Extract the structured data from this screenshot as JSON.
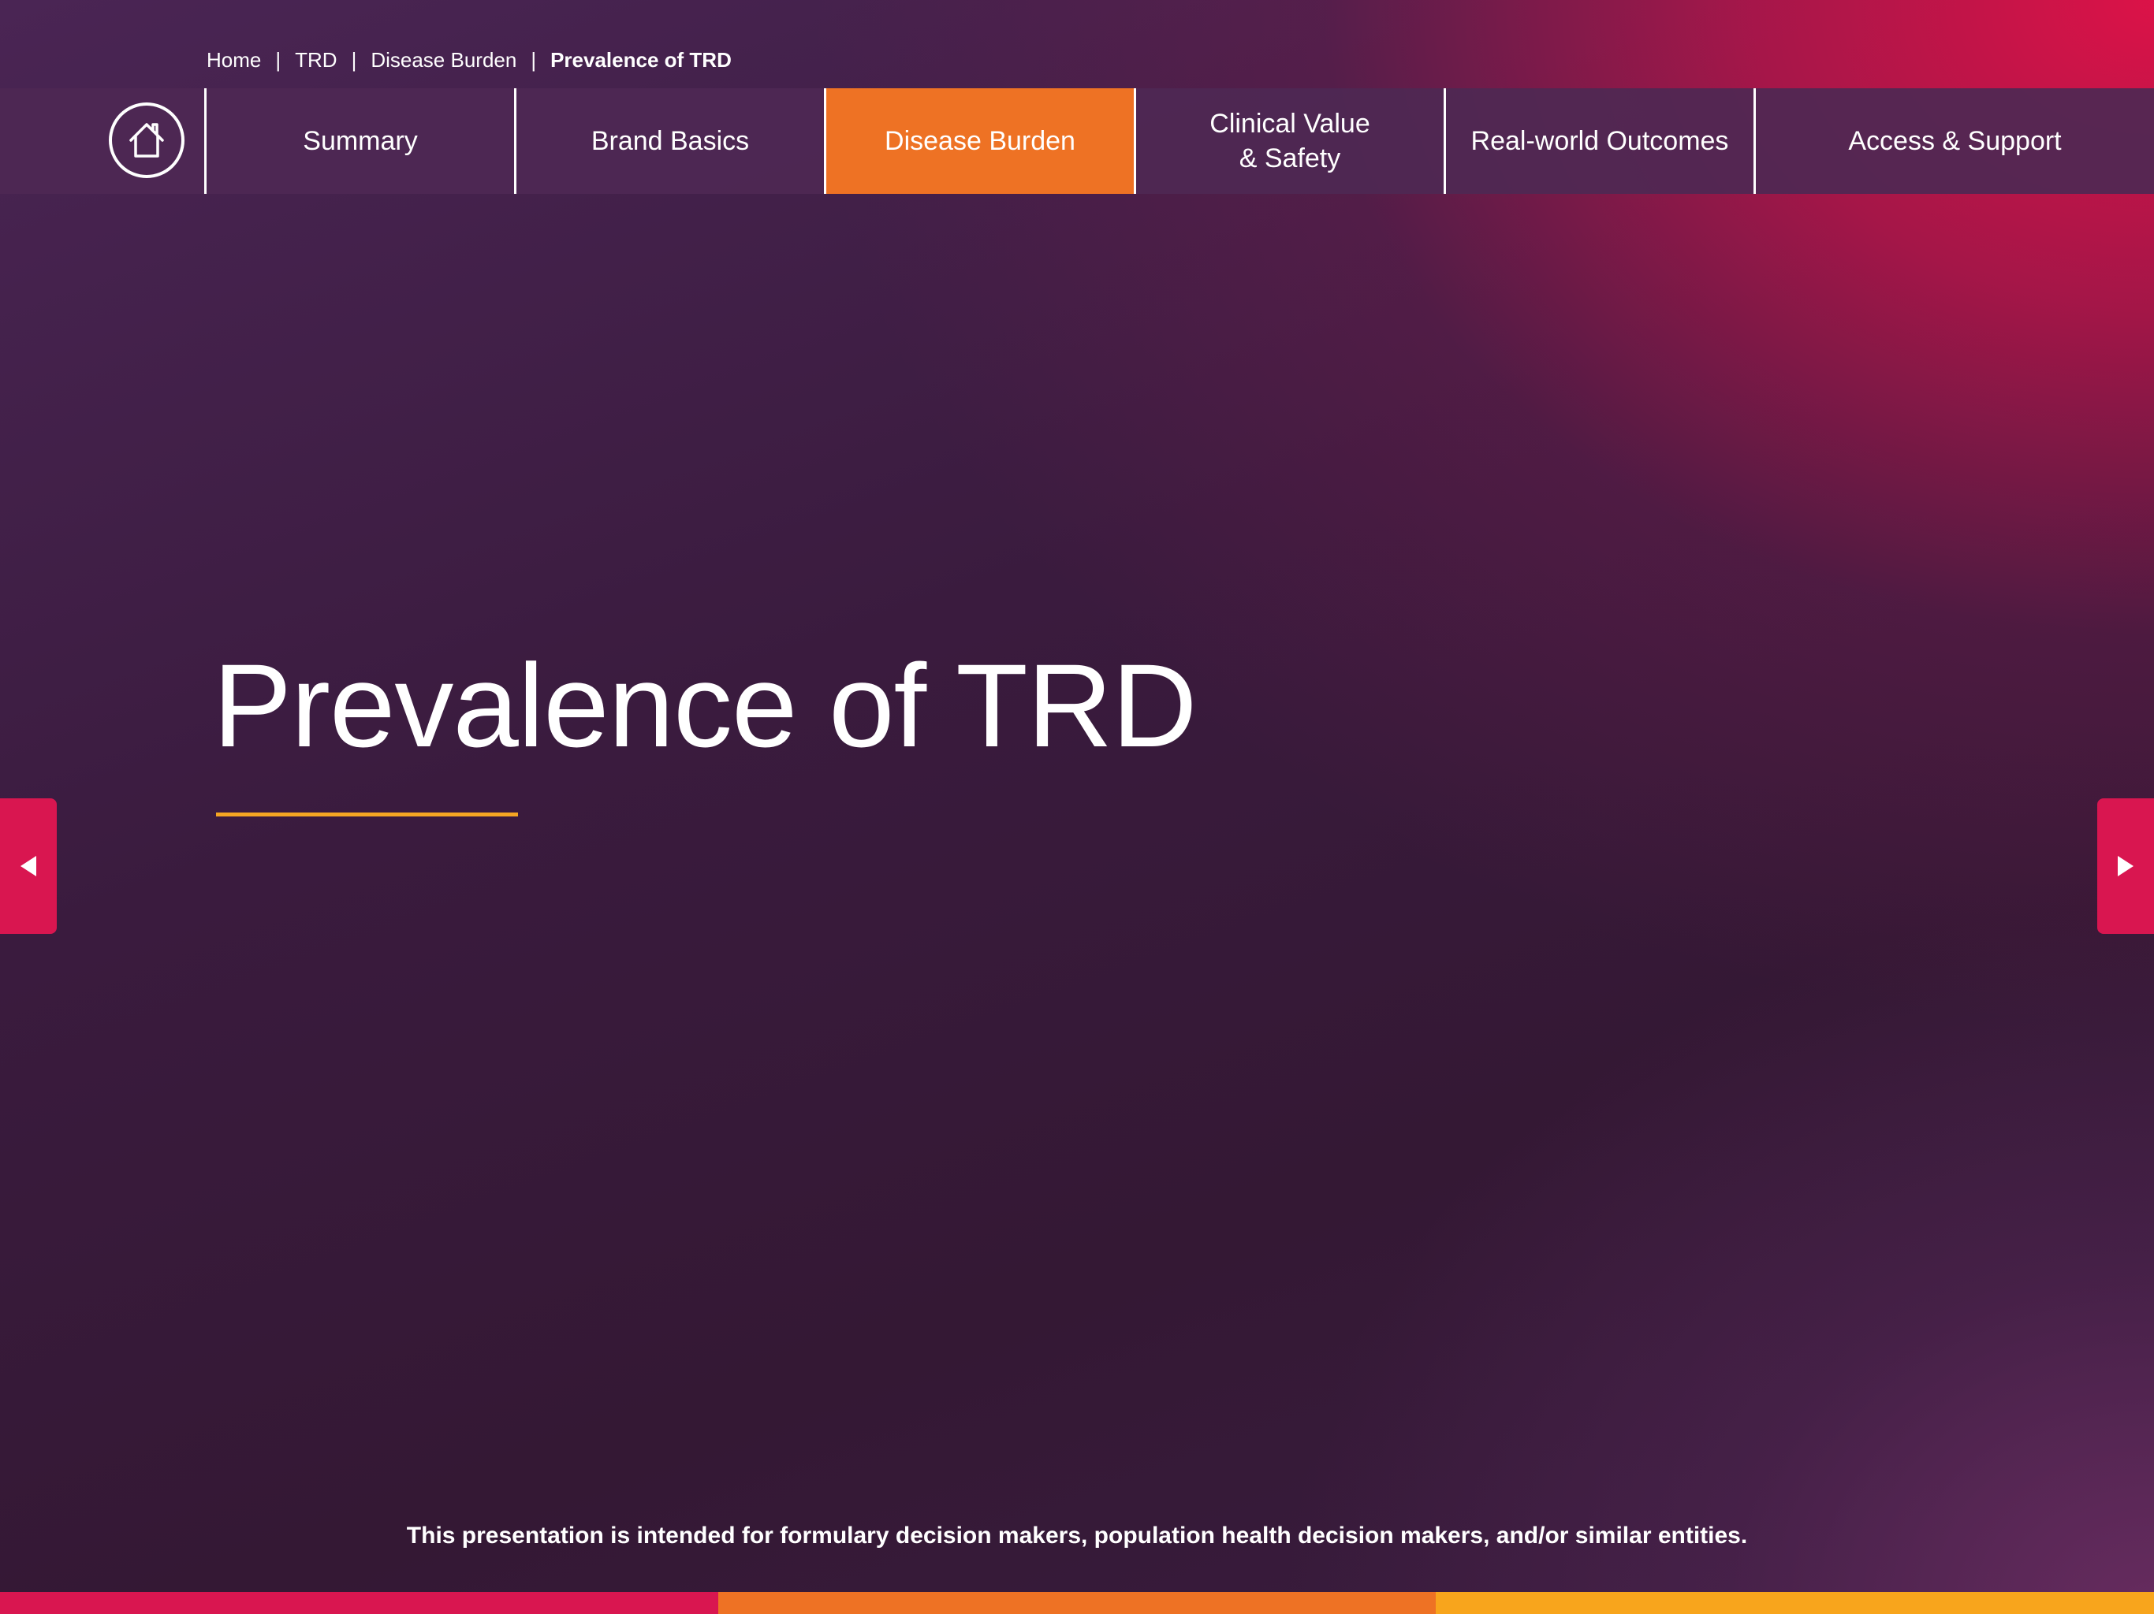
{
  "breadcrumb": {
    "items": [
      "Home",
      "TRD",
      "Disease Burden"
    ],
    "separator": "|",
    "current": "Prevalence of TRD"
  },
  "nav": {
    "home_icon": "home-icon",
    "tabs": [
      {
        "label": "Summary"
      },
      {
        "label": "Brand Basics"
      },
      {
        "label": "Disease Burden",
        "active": true
      },
      {
        "label_line1": "Clinical Value",
        "label_line2": "& Safety"
      },
      {
        "label": "Real-world Outcomes"
      },
      {
        "label": "Access & Support"
      }
    ]
  },
  "slide": {
    "title": "Prevalence of TRD"
  },
  "navigation": {
    "prev_icon": "triangle-left-icon",
    "next_icon": "triangle-right-icon"
  },
  "footer": {
    "disclaimer": "This presentation is intended for formulary decision makers, population health decision makers, and/or similar entities."
  },
  "colors": {
    "active_tab": "#ee7224",
    "arrow_button": "#d91650",
    "title_underline": "#f5a623",
    "stripe": [
      "#d91650",
      "#ee7224",
      "#f8a51c"
    ]
  }
}
